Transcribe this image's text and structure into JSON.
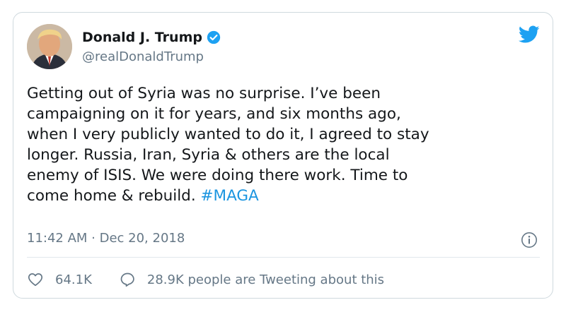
{
  "tweet": {
    "author_name": "Donald J. Trump",
    "handle": "@realDonaldTrump",
    "text": "Getting out of Syria was no surprise. I’ve been\ncampaigning on it for years, and six months ago,\nwhen I very publicly wanted to do it, I agreed to stay\nlonger. Russia, Iran, Syria & others are the local\nenemy of ISIS. We were doing there work. Time to\ncome home & rebuild. ",
    "hashtag": "#MAGA",
    "timestamp": "11:42 AM · Dec 20, 2018"
  },
  "actions": {
    "likes": "64.1K",
    "tweeting": "28.9K people are Tweeting about this"
  },
  "colors": {
    "brand": "#1da1f2",
    "link": "#1b95e0",
    "muted": "#657786",
    "border": "#cfd9de"
  },
  "icons": [
    "verified-badge-icon",
    "twitter-bird-icon",
    "info-icon",
    "heart-icon",
    "comment-icon"
  ]
}
